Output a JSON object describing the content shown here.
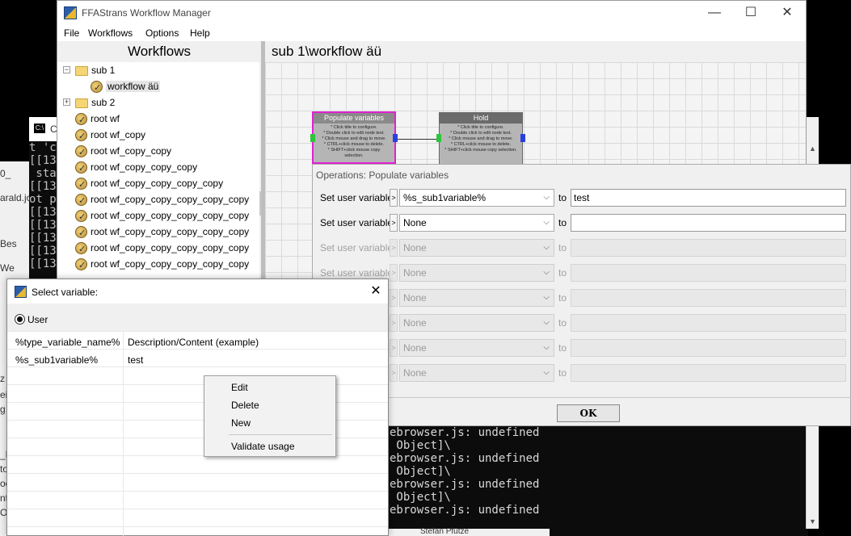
{
  "app": {
    "title": "FFAStrans Workflow Manager",
    "controls": {
      "minimize": "—",
      "maximize": "☐",
      "close": "✕"
    }
  },
  "menu": [
    "File",
    "Workflows",
    "Options",
    "Help"
  ],
  "workflows_panel": {
    "header": "Workflows",
    "tree": [
      {
        "label": "sub 1",
        "type": "folder",
        "expander": "−",
        "indent": 0
      },
      {
        "label": "workflow äü",
        "type": "workflow",
        "indent": 1,
        "selected": true
      },
      {
        "label": "sub 2",
        "type": "folder",
        "expander": "+",
        "indent": 0
      },
      {
        "label": "root wf",
        "type": "workflow",
        "indent": 0
      },
      {
        "label": "root wf_copy",
        "type": "workflow",
        "indent": 0
      },
      {
        "label": "root wf_copy_copy",
        "type": "workflow",
        "indent": 0
      },
      {
        "label": "root wf_copy_copy_copy",
        "type": "workflow",
        "indent": 0
      },
      {
        "label": "root wf_copy_copy_copy_copy",
        "type": "workflow",
        "indent": 0
      },
      {
        "label": "root wf_copy_copy_copy_copy_copy",
        "type": "workflow",
        "indent": 0
      },
      {
        "label": "root wf_copy_copy_copy_copy_copy",
        "type": "workflow",
        "indent": 0
      },
      {
        "label": "root wf_copy_copy_copy_copy_copy",
        "type": "workflow",
        "indent": 0
      },
      {
        "label": "root wf_copy_copy_copy_copy_copy",
        "type": "workflow",
        "indent": 0
      },
      {
        "label": "root wf_copy_copy_copy_copy_copy",
        "type": "workflow",
        "indent": 0
      }
    ]
  },
  "canvas": {
    "header": "sub 1\\workflow äü",
    "nodes": [
      {
        "title": "Populate variables",
        "body": "* Click title to configure.\n* Double click to edit node text.\n* Click mouse and drag to move.\n* CTRL+click mouse to delete.\n* SHIFT+click mouse copy selection.",
        "selected": true
      },
      {
        "title": "Hold",
        "body": "* Click title to configure.\n* Double click to edit node text.\n* Click mouse and drag to move.\n* CTRL+click mouse to delete.\n* SHIFT+click mouse copy selection.",
        "selected": false
      }
    ]
  },
  "operations": {
    "title": "Operations: Populate variables",
    "rows": [
      {
        "label": "Set user variable",
        "btn": ">",
        "variable": "%s_sub1variable%",
        "to": "to",
        "value": "test",
        "enabled": true
      },
      {
        "label": "Set user variable",
        "btn": ">",
        "variable": "None",
        "to": "to",
        "value": "",
        "enabled": true
      },
      {
        "label": "Set user variable",
        "btn": ">",
        "variable": "None",
        "to": "to",
        "value": "",
        "enabled": false
      },
      {
        "label": "Set user variable",
        "btn": ">",
        "variable": "None",
        "to": "to",
        "value": "",
        "enabled": false
      },
      {
        "label": "",
        "btn": ">",
        "variable": "None",
        "to": "to",
        "value": "",
        "enabled": false
      },
      {
        "label": "",
        "btn": ">",
        "variable": "None",
        "to": "to",
        "value": "",
        "enabled": false
      },
      {
        "label": "",
        "btn": ">",
        "variable": "None",
        "to": "to",
        "value": "",
        "enabled": false
      },
      {
        "label": "",
        "btn": ">",
        "variable": "None",
        "to": "to",
        "value": "",
        "enabled": false
      }
    ],
    "ok_label": "OK"
  },
  "select_variable_dialog": {
    "title": "Select variable:",
    "close": "✕",
    "radio_label": "User",
    "columns": [
      "%type_variable_name%",
      "Description/Content (example)"
    ],
    "rows": [
      [
        "%s_sub1variable%",
        "test"
      ]
    ]
  },
  "context_menu": {
    "items": [
      "Edit",
      "Delete",
      "New",
      "Validate usage"
    ]
  },
  "console": {
    "left_lines": [
      "t 'c",
      "[[13",
      " sta",
      "[[13",
      "ot p",
      "[[13",
      "[[13",
      "[[13",
      "[[13",
      "[[13"
    ],
    "right_lines": [
      "ebrowser.js: undefined",
      " Object]\\",
      "ebrowser.js: undefined",
      " Object]\\",
      "ebrowser.js: undefined",
      " Object]\\",
      "ebrowser.js: undefined"
    ],
    "title_fragment": "C",
    "strip_texts": [
      "0_",
      "arald.jo",
      "Bes",
      "We",
      "z",
      "ei",
      "g",
      "_E",
      "to",
      "oc",
      "nt",
      "Or"
    ],
    "bottom_name": "Stefan Pfütze"
  },
  "colors": {
    "selected_node_border": "#e021d0",
    "port_in": "#2ec43a",
    "port_out": "#2a3fe0",
    "canvas_grid": "#dadada"
  },
  "icons": {
    "folder": "folder-icon",
    "workflow": "workflow-check-icon",
    "app": "ffastrans-app-icon"
  }
}
